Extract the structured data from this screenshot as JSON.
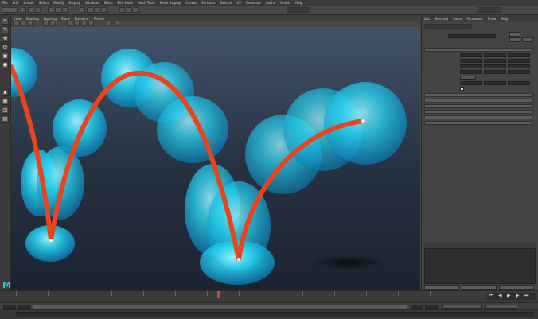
{
  "app": {
    "logo": "M"
  },
  "menubar": {
    "items": [
      "File",
      "Edit",
      "Create",
      "Select",
      "Modify",
      "Display",
      "Windows",
      "Mesh",
      "Edit Mesh",
      "Mesh Tools",
      "Mesh Display",
      "Curves",
      "Surfaces",
      "Deform",
      "UV",
      "Generate",
      "Cache",
      "Arnold",
      "Help"
    ]
  },
  "viewport_panel": {
    "menu": [
      "View",
      "Shading",
      "Lighting",
      "Show",
      "Renderer",
      "Panels"
    ]
  },
  "attribute_editor": {
    "tabs": [
      "List",
      "Selected",
      "Focus",
      "Attributes",
      "Show",
      "Help"
    ]
  },
  "colors": {
    "sphere": "#22d4f2",
    "motion_trail": "#e8451c",
    "viewport_top": "#43536a",
    "viewport_bottom": "#1c2431",
    "logo": "#2ec6d8"
  }
}
